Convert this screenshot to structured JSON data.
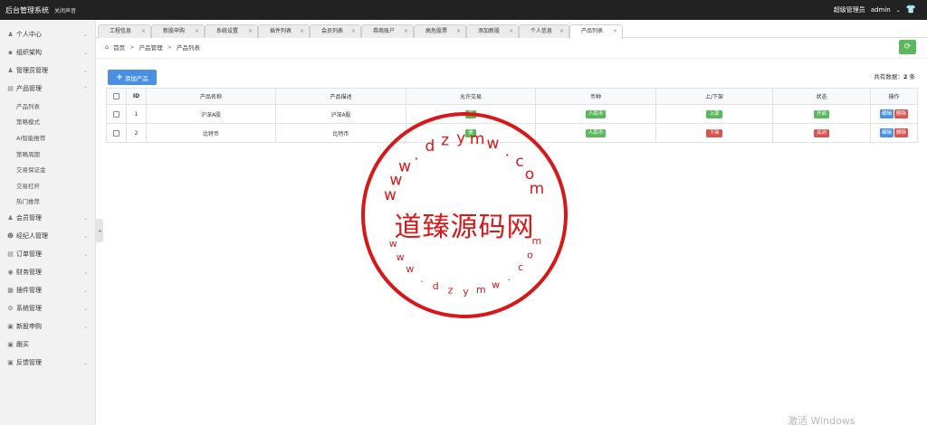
{
  "topbar": {
    "brand": "后台管理系统",
    "mute_label": "关闭声音",
    "role": "超级管理员",
    "username": "admin",
    "dropdown_icon": "chevron-down-icon",
    "shirt_icon": "tshirt-icon"
  },
  "sidebar": {
    "items": [
      {
        "label": "个人中心",
        "icon": "user-icon",
        "arrow": "⌄"
      },
      {
        "label": "组织架构",
        "icon": "sitemap-icon",
        "arrow": "⌄"
      },
      {
        "label": "管理员管理",
        "icon": "admin-icon",
        "arrow": "⌄"
      },
      {
        "label": "产品管理",
        "icon": "product-icon",
        "arrow": "⌃"
      },
      {
        "label": "会员管理",
        "icon": "member-icon",
        "arrow": "⌄"
      },
      {
        "label": "经纪人管理",
        "icon": "broker-icon",
        "arrow": "⌄"
      },
      {
        "label": "订单管理",
        "icon": "order-icon",
        "arrow": "⌄"
      },
      {
        "label": "财务管理",
        "icon": "finance-icon",
        "arrow": "⌄"
      },
      {
        "label": "插件管理",
        "icon": "plugin-icon",
        "arrow": "⌄"
      },
      {
        "label": "系统管理",
        "icon": "system-icon",
        "arrow": "⌄"
      },
      {
        "label": "新股申购",
        "icon": "ipo-icon",
        "arrow": "⌄"
      },
      {
        "label": "跟买",
        "icon": "follow-icon",
        "arrow": ""
      },
      {
        "label": "反馈管理",
        "icon": "feedback-icon",
        "arrow": "⌄"
      }
    ],
    "subitems": [
      "产品列表",
      "策略模式",
      "AI智能推荐",
      "策略周期",
      "交易保证金",
      "交易杠杆",
      "热门推荐"
    ]
  },
  "tabs": [
    {
      "label": "工程信息",
      "close": "×"
    },
    {
      "label": "新股申购",
      "close": "×"
    },
    {
      "label": "系统设置",
      "close": "×"
    },
    {
      "label": "插件列表",
      "close": "×"
    },
    {
      "label": "会员列表",
      "close": "×"
    },
    {
      "label": "券商账户",
      "close": "×"
    },
    {
      "label": "高危股票",
      "close": "×"
    },
    {
      "label": "添加新股",
      "close": "×"
    },
    {
      "label": "个人信息",
      "close": "×"
    },
    {
      "label": "产品列表",
      "close": "×"
    }
  ],
  "breadcrumb": {
    "home": "首页",
    "sep": ">",
    "level1": "产品管理",
    "level2": "产品列表"
  },
  "toolbar": {
    "add_label": "添加产品",
    "total_label": "共有数据：",
    "total_count": "2",
    "total_unit": "条"
  },
  "table": {
    "headers": [
      "",
      "ID",
      "产品名称",
      "产品描述",
      "允许交易",
      "币种",
      "上/下架",
      "状态",
      "操作"
    ],
    "rows": [
      {
        "id": "1",
        "name": "沪深A股",
        "desc": "沪深A股",
        "trade": "是",
        "currency": "人民币",
        "shelf": "上架",
        "status": "开启",
        "edit": "编辑",
        "delete": "删除"
      },
      {
        "id": "2",
        "name": "比特币",
        "desc": "比特币",
        "trade": "是",
        "currency": "人民币",
        "shelf": "下架",
        "status": "关闭",
        "edit": "编辑",
        "delete": "删除"
      }
    ]
  },
  "watermark": {
    "center": "道臻源码网",
    "ring_top": [
      "w",
      "w",
      "w",
      ".",
      "d",
      "z",
      "y",
      "m",
      "w",
      ".",
      "c",
      "o",
      "m"
    ],
    "ring_bottom": [
      "w",
      "w",
      "w",
      ".",
      "d",
      "z",
      "y",
      "m",
      "w",
      ".",
      "c",
      "o",
      "m"
    ],
    "color": "#d81818"
  },
  "os_watermark": "激活 Windows",
  "colors": {
    "topbar": "#222222",
    "green": "#5cb85c",
    "red": "#d9534f",
    "blue": "#4a90e2"
  }
}
